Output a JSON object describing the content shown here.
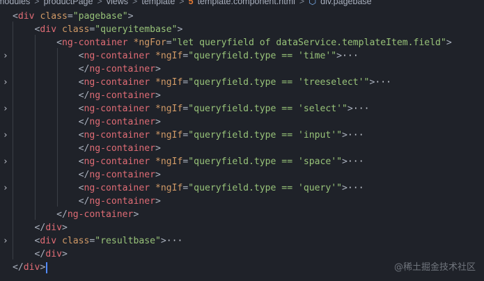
{
  "breadcrumb": {
    "items": [
      "modules",
      "productPage",
      "views",
      "template",
      "template.component.html",
      "div.pagebase"
    ],
    "separator": ">"
  },
  "lines": [
    {
      "fold": false,
      "tokens": [
        [
          "p",
          "<"
        ],
        [
          "t",
          "div"
        ],
        [
          "p",
          " "
        ],
        [
          "a",
          "class"
        ],
        [
          "p",
          "="
        ],
        [
          "s",
          "\"pagebase\""
        ],
        [
          "p",
          ">"
        ]
      ]
    },
    {
      "fold": false,
      "tokens": [
        [
          "p",
          "    <"
        ],
        [
          "t",
          "div"
        ],
        [
          "p",
          " "
        ],
        [
          "a",
          "class"
        ],
        [
          "p",
          "="
        ],
        [
          "s",
          "\"queryitembase\""
        ],
        [
          "p",
          ">"
        ]
      ]
    },
    {
      "fold": false,
      "tokens": [
        [
          "p",
          "        <"
        ],
        [
          "t",
          "ng-container"
        ],
        [
          "p",
          " "
        ],
        [
          "a",
          "*ngFor"
        ],
        [
          "p",
          "="
        ],
        [
          "s",
          "\"let queryfield of dataService.templateItem.field\""
        ],
        [
          "p",
          ">"
        ]
      ]
    },
    {
      "fold": true,
      "tokens": [
        [
          "p",
          "            <"
        ],
        [
          "t",
          "ng-container"
        ],
        [
          "p",
          " "
        ],
        [
          "a",
          "*ngIf"
        ],
        [
          "p",
          "="
        ],
        [
          "s",
          "\"queryfield.type == 'time'\""
        ],
        [
          "p",
          ">"
        ],
        [
          "e",
          "···"
        ]
      ]
    },
    {
      "fold": false,
      "tokens": [
        [
          "p",
          "            </"
        ],
        [
          "t",
          "ng-container"
        ],
        [
          "p",
          ">"
        ]
      ]
    },
    {
      "fold": true,
      "tokens": [
        [
          "p",
          "            <"
        ],
        [
          "t",
          "ng-container"
        ],
        [
          "p",
          " "
        ],
        [
          "a",
          "*ngIf"
        ],
        [
          "p",
          "="
        ],
        [
          "s",
          "\"queryfield.type == 'treeselect'\""
        ],
        [
          "p",
          ">"
        ],
        [
          "e",
          "···"
        ]
      ]
    },
    {
      "fold": false,
      "tokens": [
        [
          "p",
          "            </"
        ],
        [
          "t",
          "ng-container"
        ],
        [
          "p",
          ">"
        ]
      ]
    },
    {
      "fold": true,
      "tokens": [
        [
          "p",
          "            <"
        ],
        [
          "t",
          "ng-container"
        ],
        [
          "p",
          " "
        ],
        [
          "a",
          "*ngIf"
        ],
        [
          "p",
          "="
        ],
        [
          "s",
          "\"queryfield.type == 'select'\""
        ],
        [
          "p",
          ">"
        ],
        [
          "e",
          "···"
        ]
      ]
    },
    {
      "fold": false,
      "tokens": [
        [
          "p",
          "            </"
        ],
        [
          "t",
          "ng-container"
        ],
        [
          "p",
          ">"
        ]
      ]
    },
    {
      "fold": true,
      "tokens": [
        [
          "p",
          "            <"
        ],
        [
          "t",
          "ng-container"
        ],
        [
          "p",
          " "
        ],
        [
          "a",
          "*ngIf"
        ],
        [
          "p",
          "="
        ],
        [
          "s",
          "\"queryfield.type == 'input'\""
        ],
        [
          "p",
          ">"
        ],
        [
          "e",
          "···"
        ]
      ]
    },
    {
      "fold": false,
      "tokens": [
        [
          "p",
          "            </"
        ],
        [
          "t",
          "ng-container"
        ],
        [
          "p",
          ">"
        ]
      ]
    },
    {
      "fold": true,
      "tokens": [
        [
          "p",
          "            <"
        ],
        [
          "t",
          "ng-container"
        ],
        [
          "p",
          " "
        ],
        [
          "a",
          "*ngIf"
        ],
        [
          "p",
          "="
        ],
        [
          "s",
          "\"queryfield.type == 'space'\""
        ],
        [
          "p",
          ">"
        ],
        [
          "e",
          "···"
        ]
      ]
    },
    {
      "fold": false,
      "tokens": [
        [
          "p",
          "            </"
        ],
        [
          "t",
          "ng-container"
        ],
        [
          "p",
          ">"
        ]
      ]
    },
    {
      "fold": true,
      "tokens": [
        [
          "p",
          "            <"
        ],
        [
          "t",
          "ng-container"
        ],
        [
          "p",
          " "
        ],
        [
          "a",
          "*ngIf"
        ],
        [
          "p",
          "="
        ],
        [
          "s",
          "\"queryfield.type == 'query'\""
        ],
        [
          "p",
          ">"
        ],
        [
          "e",
          "···"
        ]
      ]
    },
    {
      "fold": false,
      "tokens": [
        [
          "p",
          "            </"
        ],
        [
          "t",
          "ng-container"
        ],
        [
          "p",
          ">"
        ]
      ]
    },
    {
      "fold": false,
      "tokens": [
        [
          "p",
          "        </"
        ],
        [
          "t",
          "ng-container"
        ],
        [
          "p",
          ">"
        ]
      ]
    },
    {
      "fold": false,
      "tokens": [
        [
          "p",
          "    </"
        ],
        [
          "t",
          "div"
        ],
        [
          "p",
          ">"
        ]
      ]
    },
    {
      "fold": true,
      "tokens": [
        [
          "p",
          "    <"
        ],
        [
          "t",
          "div"
        ],
        [
          "p",
          " "
        ],
        [
          "a",
          "class"
        ],
        [
          "p",
          "="
        ],
        [
          "s",
          "\"resultbase\""
        ],
        [
          "p",
          ">"
        ],
        [
          "e",
          "···"
        ]
      ]
    },
    {
      "fold": false,
      "tokens": [
        [
          "p",
          "    </"
        ],
        [
          "t",
          "div"
        ],
        [
          "p",
          ">"
        ]
      ]
    },
    {
      "fold": false,
      "tokens": [
        [
          "p",
          "</"
        ],
        [
          "t",
          "div"
        ],
        [
          "p",
          ">"
        ]
      ],
      "cursor": true
    }
  ],
  "watermark": "@稀土掘金技术社区"
}
